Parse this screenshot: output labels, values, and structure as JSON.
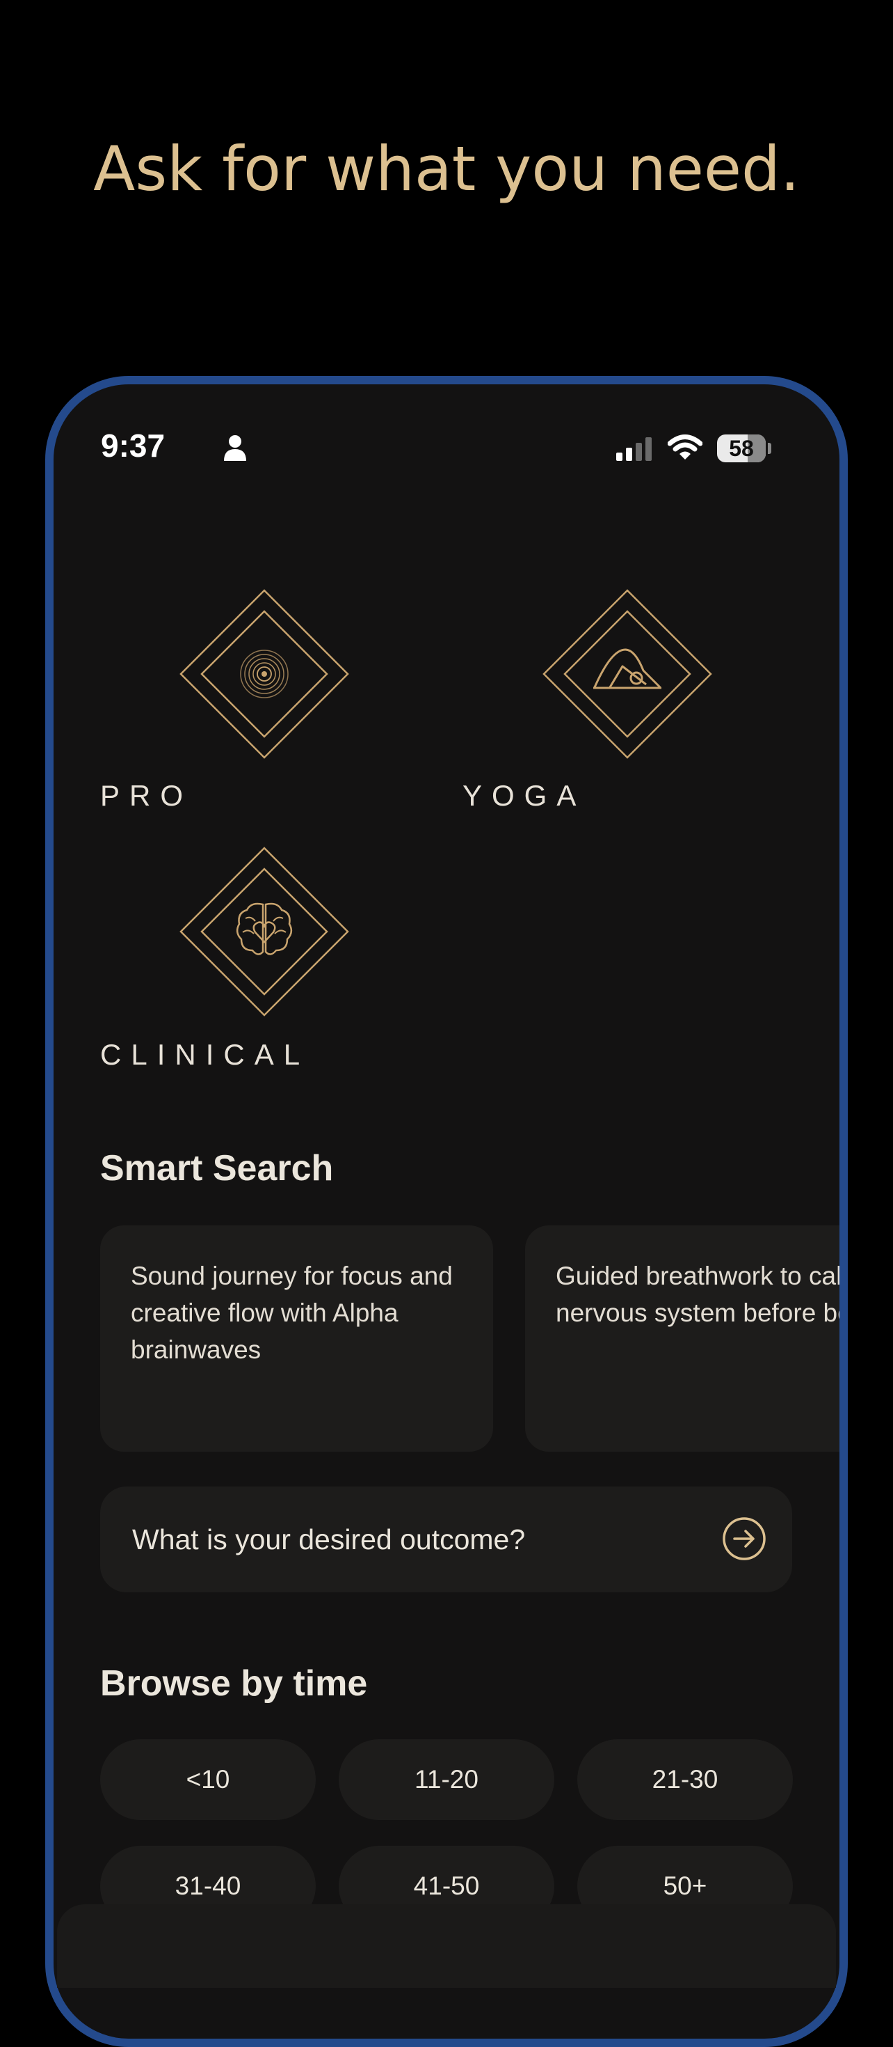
{
  "headline": "Ask for what you need.",
  "status_bar": {
    "time": "9:37",
    "battery": "58",
    "icons": [
      "person-icon",
      "signal-icon",
      "wifi-icon",
      "battery-icon"
    ]
  },
  "categories": [
    {
      "label": "PRO",
      "icon": "sound-rings-icon"
    },
    {
      "label": "YOGA",
      "icon": "yoga-pose-icon"
    },
    {
      "label": "CLINICAL",
      "icon": "brain-heart-icon"
    }
  ],
  "smart_search": {
    "title": "Smart Search",
    "cards": [
      "Sound journey for focus and creative flow with Alpha brainwaves",
      "Guided breathwork to calm my nervous system before bed"
    ],
    "prompt_placeholder": "What is your desired outcome?"
  },
  "browse_by_time": {
    "title": "Browse by time",
    "chips": [
      "<10",
      "11-20",
      "21-30",
      "31-40",
      "41-50",
      "50+"
    ]
  },
  "colors": {
    "accent_gold": "#c9a46e",
    "headline_gold": "#dcc090",
    "phone_frame": "#244a8c",
    "surface": "#131212",
    "card": "#1d1c1b"
  }
}
